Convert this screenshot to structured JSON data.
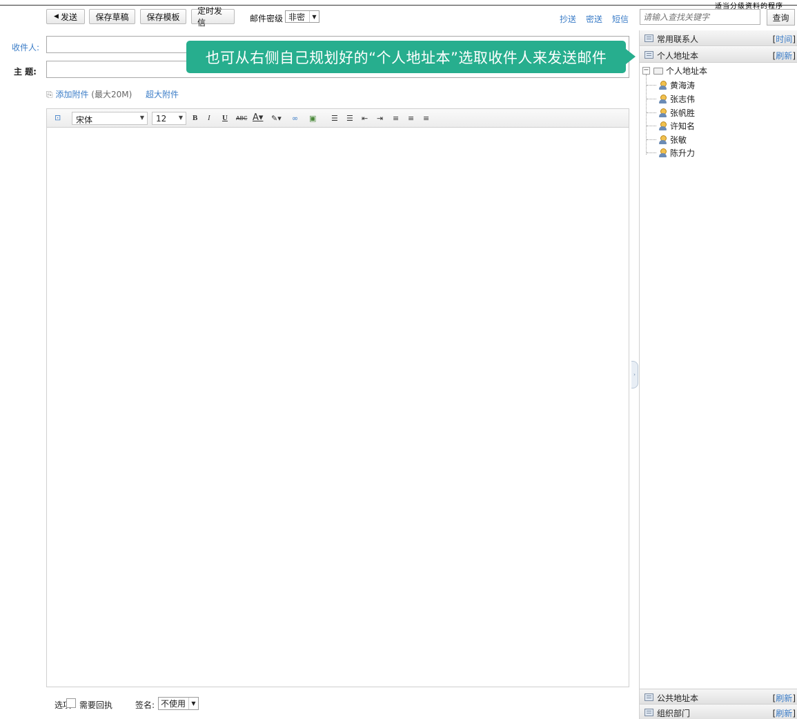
{
  "header": {
    "corner_text": "适当分级资料的程序"
  },
  "toolbar": {
    "send_label": "发送",
    "save_draft_label": "保存草稿",
    "save_template_label": "保存模板",
    "timed_send_label": "定时发信",
    "security_label": "邮件密级",
    "security_value": "非密",
    "cc_label": "抄送",
    "bcc_label": "密送",
    "sms_label": "短信"
  },
  "search": {
    "placeholder": "请输入查找关键字",
    "button_label": "查询"
  },
  "compose": {
    "recipients_label": "收件人:",
    "subject_label": "主 题:",
    "add_attachment_label": "添加附件",
    "attachment_limit": "(最大20M)",
    "large_attachment_label": "超大附件"
  },
  "editor": {
    "font_family": "宋体",
    "font_size": "12"
  },
  "options": {
    "options_label": "选项",
    "receipt_label": "需要回执",
    "signature_label": "签名:",
    "signature_value": "不使用"
  },
  "tooltip": {
    "text": "也可从右侧自己规划好的“个人地址本”选取收件人来发送邮件"
  },
  "right_panel": {
    "frequent_contacts": {
      "label": "常用联系人",
      "link": "时间"
    },
    "personal_book": {
      "label": "个人地址本",
      "link": "刷新"
    },
    "tree_root": "个人地址本",
    "contacts": [
      "黄海涛",
      "张志伟",
      "张帆胜",
      "许知名",
      "张敏",
      "陈升力"
    ],
    "public_book": {
      "label": "公共地址本",
      "link": "刷新"
    },
    "org_dept": {
      "label": "组织部门",
      "link": "刷新"
    }
  }
}
